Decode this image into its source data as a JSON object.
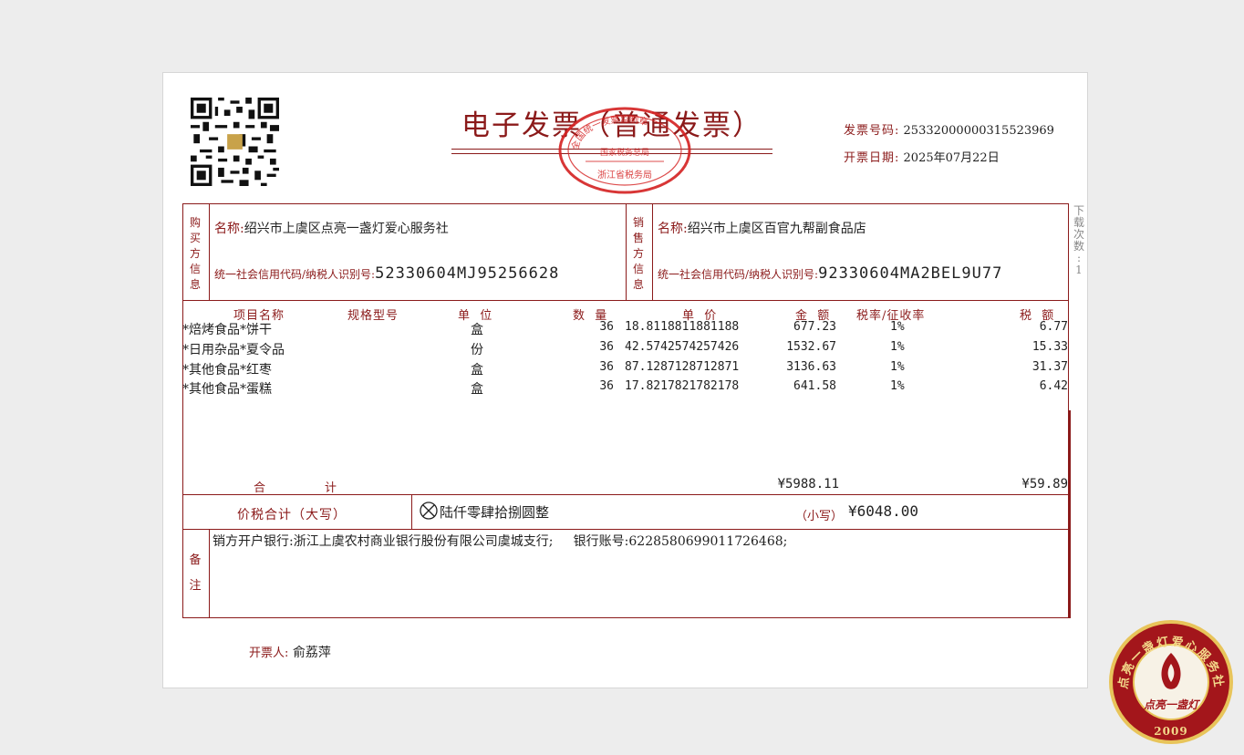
{
  "invoice": {
    "title": "电子发票（普通发票）",
    "number_label": "发票号码:",
    "number": "25332000000315523969",
    "date_label": "开票日期:",
    "date": "2025年07月22日"
  },
  "stamp": {
    "top": "全国统一发票监制章",
    "middle": "国家税务总局",
    "bottom": "浙江省税务局"
  },
  "buyer": {
    "section_label": [
      "购",
      "买",
      "方",
      "信",
      "息"
    ],
    "name_label": "名称:",
    "name": "绍兴市上虞区点亮一盏灯爱心服务社",
    "id_label": "统一社会信用代码/纳税人识别号:",
    "id": "52330604MJ95256628"
  },
  "seller": {
    "section_label": [
      "销",
      "售",
      "方",
      "信",
      "息"
    ],
    "name_label": "名称:",
    "name": "绍兴市上虞区百官九帮副食品店",
    "id_label": "统一社会信用代码/纳税人识别号:",
    "id": "92330604MA2BEL9U77"
  },
  "table": {
    "headers": {
      "item": "项目名称",
      "spec": "规格型号",
      "unit": "单  位",
      "qty": "数  量",
      "price": "单  价",
      "amount": "金  额",
      "rate": "税率/征收率",
      "tax": "税  额"
    },
    "rows": [
      {
        "item": "*焙烤食品*饼干",
        "unit": "盒",
        "qty": "36",
        "price": "18.8118811881188",
        "amount": "677.23",
        "rate": "1%",
        "tax": "6.77"
      },
      {
        "item": "*日用杂品*夏令品",
        "unit": "份",
        "qty": "36",
        "price": "42.5742574257426",
        "amount": "1532.67",
        "rate": "1%",
        "tax": "15.33"
      },
      {
        "item": "*其他食品*红枣",
        "unit": "盒",
        "qty": "36",
        "price": "87.1287128712871",
        "amount": "3136.63",
        "rate": "1%",
        "tax": "31.37"
      },
      {
        "item": "*其他食品*蛋糕",
        "unit": "盒",
        "qty": "36",
        "price": "17.8217821782178",
        "amount": "641.58",
        "rate": "1%",
        "tax": "6.42"
      }
    ],
    "total_label_1": "合",
    "total_label_2": "计",
    "total_amount": "¥5988.11",
    "total_tax": "¥59.89"
  },
  "grand_total": {
    "label": "价税合计（大写）",
    "words": "陆仟零肆拾捌圆整",
    "small_label": "（小写）",
    "amount": "¥6048.00"
  },
  "remarks": {
    "label_1": "备",
    "label_2": "注",
    "text": "销方开户银行:浙江上虞农村商业银行股份有限公司虞城支行;     银行账号:6228580699011726468;"
  },
  "issuer": {
    "label": "开票人:",
    "name": "俞荔萍"
  },
  "side_note": [
    "下",
    "载",
    "次",
    "数",
    ":",
    "1"
  ],
  "badge": {
    "ring_text": "点亮一盏灯爱心服务社",
    "script": "点亮一盏灯",
    "year": "2009"
  }
}
